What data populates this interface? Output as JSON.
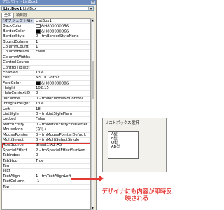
{
  "window": {
    "title": "プロパティ - ListBox1",
    "close_label": "×"
  },
  "object_selector": {
    "name": "ListBox1",
    "type": "ListBox",
    "arrow": "▾"
  },
  "tabs": [
    {
      "label": "全体"
    },
    {
      "label": "項目別"
    }
  ],
  "properties": [
    {
      "name": "(オブジェクト名)",
      "value": "ListBox1"
    },
    {
      "name": "BackColor",
      "value": "&H80000005&",
      "swatch": "#ffffff"
    },
    {
      "name": "BorderColor",
      "value": "&H80000006&",
      "swatch": "#000000"
    },
    {
      "name": "BorderStyle",
      "value": "0 - fmBorderStyleNone"
    },
    {
      "name": "BoundColumn",
      "value": "1"
    },
    {
      "name": "ColumnCount",
      "value": "1"
    },
    {
      "name": "ColumnHeads",
      "value": "False"
    },
    {
      "name": "ColumnWidths",
      "value": ""
    },
    {
      "name": "ControlSource",
      "value": ""
    },
    {
      "name": "ControlTipText",
      "value": ""
    },
    {
      "name": "Enabled",
      "value": "True"
    },
    {
      "name": "Font",
      "value": "MS UI Gothic"
    },
    {
      "name": "ForeColor",
      "value": "&H80000008&",
      "swatch": "#000000"
    },
    {
      "name": "Height",
      "value": "102.15"
    },
    {
      "name": "HelpContextID",
      "value": "0"
    },
    {
      "name": "IMEMode",
      "value": "0 - fmIMEModeNoControl"
    },
    {
      "name": "IntegralHeight",
      "value": "True"
    },
    {
      "name": "Left",
      "value": "18"
    },
    {
      "name": "ListStyle",
      "value": "0 - fmListStylePlain"
    },
    {
      "name": "Locked",
      "value": "False"
    },
    {
      "name": "MatchEntry",
      "value": "0 - fmMatchEntryFirstLetter"
    },
    {
      "name": "MouseIcon",
      "value": "(なし)"
    },
    {
      "name": "MousePointer",
      "value": "0 - fmMousePointerDefault"
    },
    {
      "name": "MultiSelect",
      "value": "0 - fmMultiSelectSingle"
    },
    {
      "name": "RowSource",
      "value": "Sheet1!A2:A5"
    },
    {
      "name": "SpecialEffect",
      "value": "2 - fmSpecialEffectSunken"
    },
    {
      "name": "TabIndex",
      "value": "0"
    },
    {
      "name": "TabStop",
      "value": "True"
    },
    {
      "name": "Tag",
      "value": ""
    },
    {
      "name": "Text",
      "value": ""
    },
    {
      "name": "TextAlign",
      "value": "1 - fmTextAlignLeft"
    },
    {
      "name": "TextColumn",
      "value": "-1"
    },
    {
      "name": "Top",
      "value": ""
    }
  ],
  "form_preview": {
    "title": "リストボックス選択",
    "items": [
      "A型",
      "B型",
      "O型",
      "AB型"
    ]
  },
  "caption": "デザイナにも内容が即時反映される",
  "colors": {
    "accent_red": "#e53935",
    "titlebar": "#6c8bbf"
  }
}
